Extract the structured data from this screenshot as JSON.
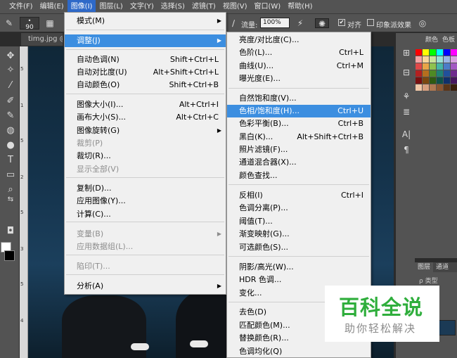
{
  "menubar": {
    "items": [
      "文件(F)",
      "编辑(E)",
      "图像(I)",
      "图层(L)",
      "文字(Y)",
      "选择(S)",
      "滤镜(T)",
      "视图(V)",
      "窗口(W)",
      "帮助(H)"
    ]
  },
  "options": {
    "brush_size": "90",
    "flow_label": "流量:",
    "flow_value": "100%",
    "align_label": "对齐",
    "align_checked": "✔",
    "sample_label": "印象派效果"
  },
  "document": {
    "tab_label": "timg.jpg @"
  },
  "ruler": {
    "marks": [
      "5",
      "1",
      "5",
      "2",
      "5",
      "3",
      "5",
      "4"
    ]
  },
  "image_menu": {
    "items": [
      {
        "label": "模式(M)",
        "shortcut": "",
        "submenu": true,
        "disabled": false
      },
      {
        "label": "调整(J)",
        "shortcut": "",
        "submenu": true,
        "disabled": false,
        "active": true
      },
      {
        "label": "自动色调(N)",
        "shortcut": "Shift+Ctrl+L",
        "disabled": false
      },
      {
        "label": "自动对比度(U)",
        "shortcut": "Alt+Shift+Ctrl+L",
        "disabled": false
      },
      {
        "label": "自动颜色(O)",
        "shortcut": "Shift+Ctrl+B",
        "disabled": false
      },
      {
        "label": "图像大小(I)...",
        "shortcut": "Alt+Ctrl+I",
        "disabled": false
      },
      {
        "label": "画布大小(S)...",
        "shortcut": "Alt+Ctrl+C",
        "disabled": false
      },
      {
        "label": "图像旋转(G)",
        "shortcut": "",
        "submenu": true,
        "disabled": false
      },
      {
        "label": "裁剪(P)",
        "shortcut": "",
        "disabled": true
      },
      {
        "label": "裁切(R)...",
        "shortcut": "",
        "disabled": false
      },
      {
        "label": "显示全部(V)",
        "shortcut": "",
        "disabled": true
      },
      {
        "label": "复制(D)...",
        "shortcut": "",
        "disabled": false
      },
      {
        "label": "应用图像(Y)...",
        "shortcut": "",
        "disabled": false
      },
      {
        "label": "计算(C)...",
        "shortcut": "",
        "disabled": false
      },
      {
        "label": "变量(B)",
        "shortcut": "",
        "submenu": true,
        "disabled": true
      },
      {
        "label": "应用数据组(L)...",
        "shortcut": "",
        "disabled": true
      },
      {
        "label": "陷印(T)...",
        "shortcut": "",
        "disabled": true
      },
      {
        "label": "分析(A)",
        "shortcut": "",
        "submenu": true,
        "disabled": false
      }
    ]
  },
  "adjust_menu": {
    "items": [
      {
        "label": "亮度/对比度(C)...",
        "shortcut": ""
      },
      {
        "label": "色阶(L)...",
        "shortcut": "Ctrl+L"
      },
      {
        "label": "曲线(U)...",
        "shortcut": "Ctrl+M"
      },
      {
        "label": "曝光度(E)...",
        "shortcut": ""
      },
      {
        "label": "自然饱和度(V)...",
        "shortcut": ""
      },
      {
        "label": "色相/饱和度(H)...",
        "shortcut": "Ctrl+U",
        "highlighted": true
      },
      {
        "label": "色彩平衡(B)...",
        "shortcut": "Ctrl+B"
      },
      {
        "label": "黑白(K)...",
        "shortcut": "Alt+Shift+Ctrl+B"
      },
      {
        "label": "照片滤镜(F)...",
        "shortcut": ""
      },
      {
        "label": "通道混合器(X)...",
        "shortcut": ""
      },
      {
        "label": "颜色查找...",
        "shortcut": ""
      },
      {
        "label": "反相(I)",
        "shortcut": "Ctrl+I"
      },
      {
        "label": "色调分离(P)...",
        "shortcut": ""
      },
      {
        "label": "阈值(T)...",
        "shortcut": ""
      },
      {
        "label": "渐变映射(G)...",
        "shortcut": ""
      },
      {
        "label": "可选颜色(S)...",
        "shortcut": ""
      },
      {
        "label": "阴影/高光(W)...",
        "shortcut": ""
      },
      {
        "label": "HDR 色调...",
        "shortcut": ""
      },
      {
        "label": "变化...",
        "shortcut": ""
      },
      {
        "label": "去色(D)",
        "shortcut": "Shi"
      },
      {
        "label": "匹配颜色(M)...",
        "shortcut": ""
      },
      {
        "label": "替换颜色(R)...",
        "shortcut": ""
      },
      {
        "label": "色调均化(Q)",
        "shortcut": ""
      }
    ]
  },
  "panels": {
    "swatch_tabs": [
      "颜色",
      "色板"
    ],
    "layer_tabs": [
      "图层",
      "通道"
    ],
    "kind_label": "ρ 类型"
  },
  "watermark": {
    "title": "百科全说",
    "subtitle": "助你轻松解决"
  },
  "colors": {
    "accent": "#3c8ee0",
    "menubar": "#535353",
    "menu_bg": "#f0f0f0",
    "watermark_green": "#2fae3c"
  }
}
